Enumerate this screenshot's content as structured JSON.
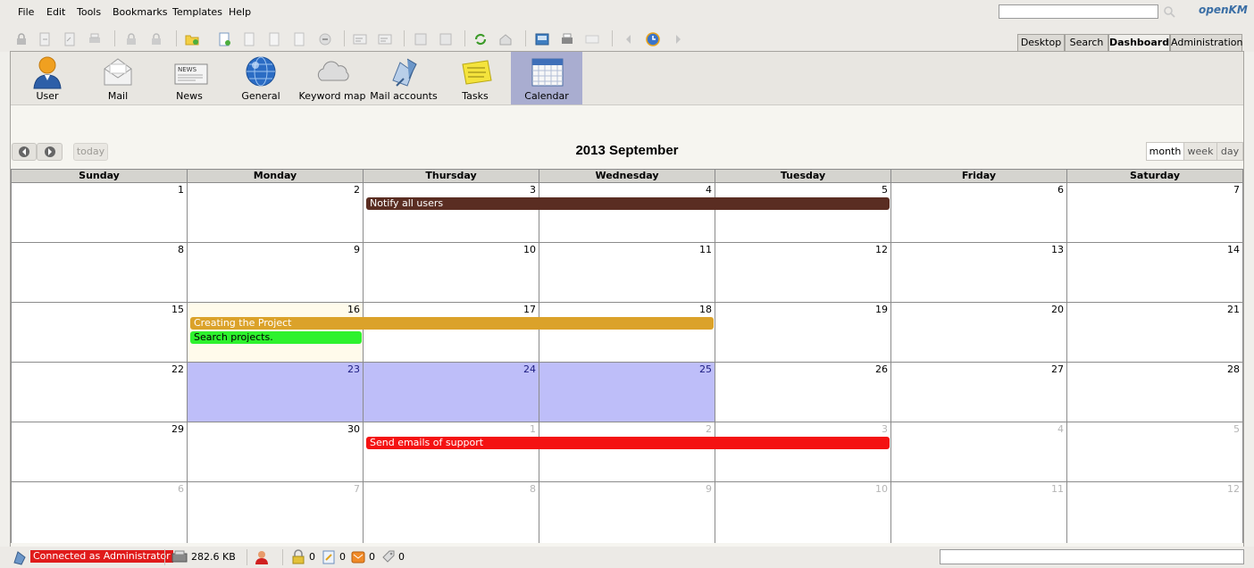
{
  "menu": [
    "File",
    "Edit",
    "Tools",
    "Bookmarks",
    "Templates",
    "Help"
  ],
  "logo": {
    "main": "penKM",
    "glyph": "o"
  },
  "search": {
    "placeholder": ""
  },
  "toolbar_icons": [
    "lock-icon",
    "checkout-icon",
    "checkin-icon",
    "print-icon",
    "lock-add-icon",
    "lock-remove-icon",
    "new-folder-icon",
    "new-document-icon",
    "add-document-icon",
    "document-properties-icon",
    "document-icon",
    "cancel-icon",
    "properties-icon",
    "note-icon",
    "add-property-icon",
    "remove-property-icon",
    "refresh-icon",
    "home-icon",
    "scanner-icon",
    "print-doc-icon",
    "convert-icon",
    "back-icon",
    "history-icon",
    "forward-icon"
  ],
  "top_tabs": [
    "Desktop",
    "Search",
    "Dashboard",
    "Administration"
  ],
  "dashboard_tabs": [
    {
      "label": "User",
      "icon": "user-icon"
    },
    {
      "label": "Mail",
      "icon": "mail-icon"
    },
    {
      "label": "News",
      "icon": "news-icon"
    },
    {
      "label": "General",
      "icon": "globe-icon"
    },
    {
      "label": "Keyword map",
      "icon": "keyword-map-icon"
    },
    {
      "label": "Mail accounts",
      "icon": "mail-accounts-icon"
    },
    {
      "label": "Tasks",
      "icon": "tasks-icon"
    },
    {
      "label": "Calendar",
      "icon": "calendar-icon"
    }
  ],
  "calendar": {
    "title": "2013 September",
    "today_label": "today",
    "views": [
      "month",
      "week",
      "day"
    ],
    "active_view": "month",
    "weekdays": [
      "Sunday",
      "Monday",
      "Thursday",
      "Wednesday",
      "Tuesday",
      "Friday",
      "Saturday"
    ],
    "weeks": [
      [
        "1",
        "2",
        "3",
        "4",
        "5",
        "6",
        "7"
      ],
      [
        "8",
        "9",
        "10",
        "11",
        "12",
        "13",
        "14"
      ],
      [
        "15",
        "16",
        "17",
        "18",
        "19",
        "20",
        "21"
      ],
      [
        "22",
        "23",
        "24",
        "25",
        "26",
        "27",
        "28"
      ],
      [
        "29",
        "30",
        "1",
        "2",
        "3",
        "4",
        "5"
      ],
      [
        "6",
        "7",
        "8",
        "9",
        "10",
        "11",
        "12"
      ]
    ],
    "events": [
      {
        "title": "Notify all users",
        "color": "#5a2d22"
      },
      {
        "title": "Creating the Project",
        "color": "#dba22a"
      },
      {
        "title": "Search projects.",
        "color": "#2ef22e",
        "text_color": "#000000"
      },
      {
        "title": "Send emails of support",
        "color": "#f41212"
      }
    ]
  },
  "status": {
    "connected": "Connected as Administrator",
    "size": "282.6 KB",
    "locked": "0",
    "checkout": "0",
    "mail": "0",
    "tags": "0"
  }
}
